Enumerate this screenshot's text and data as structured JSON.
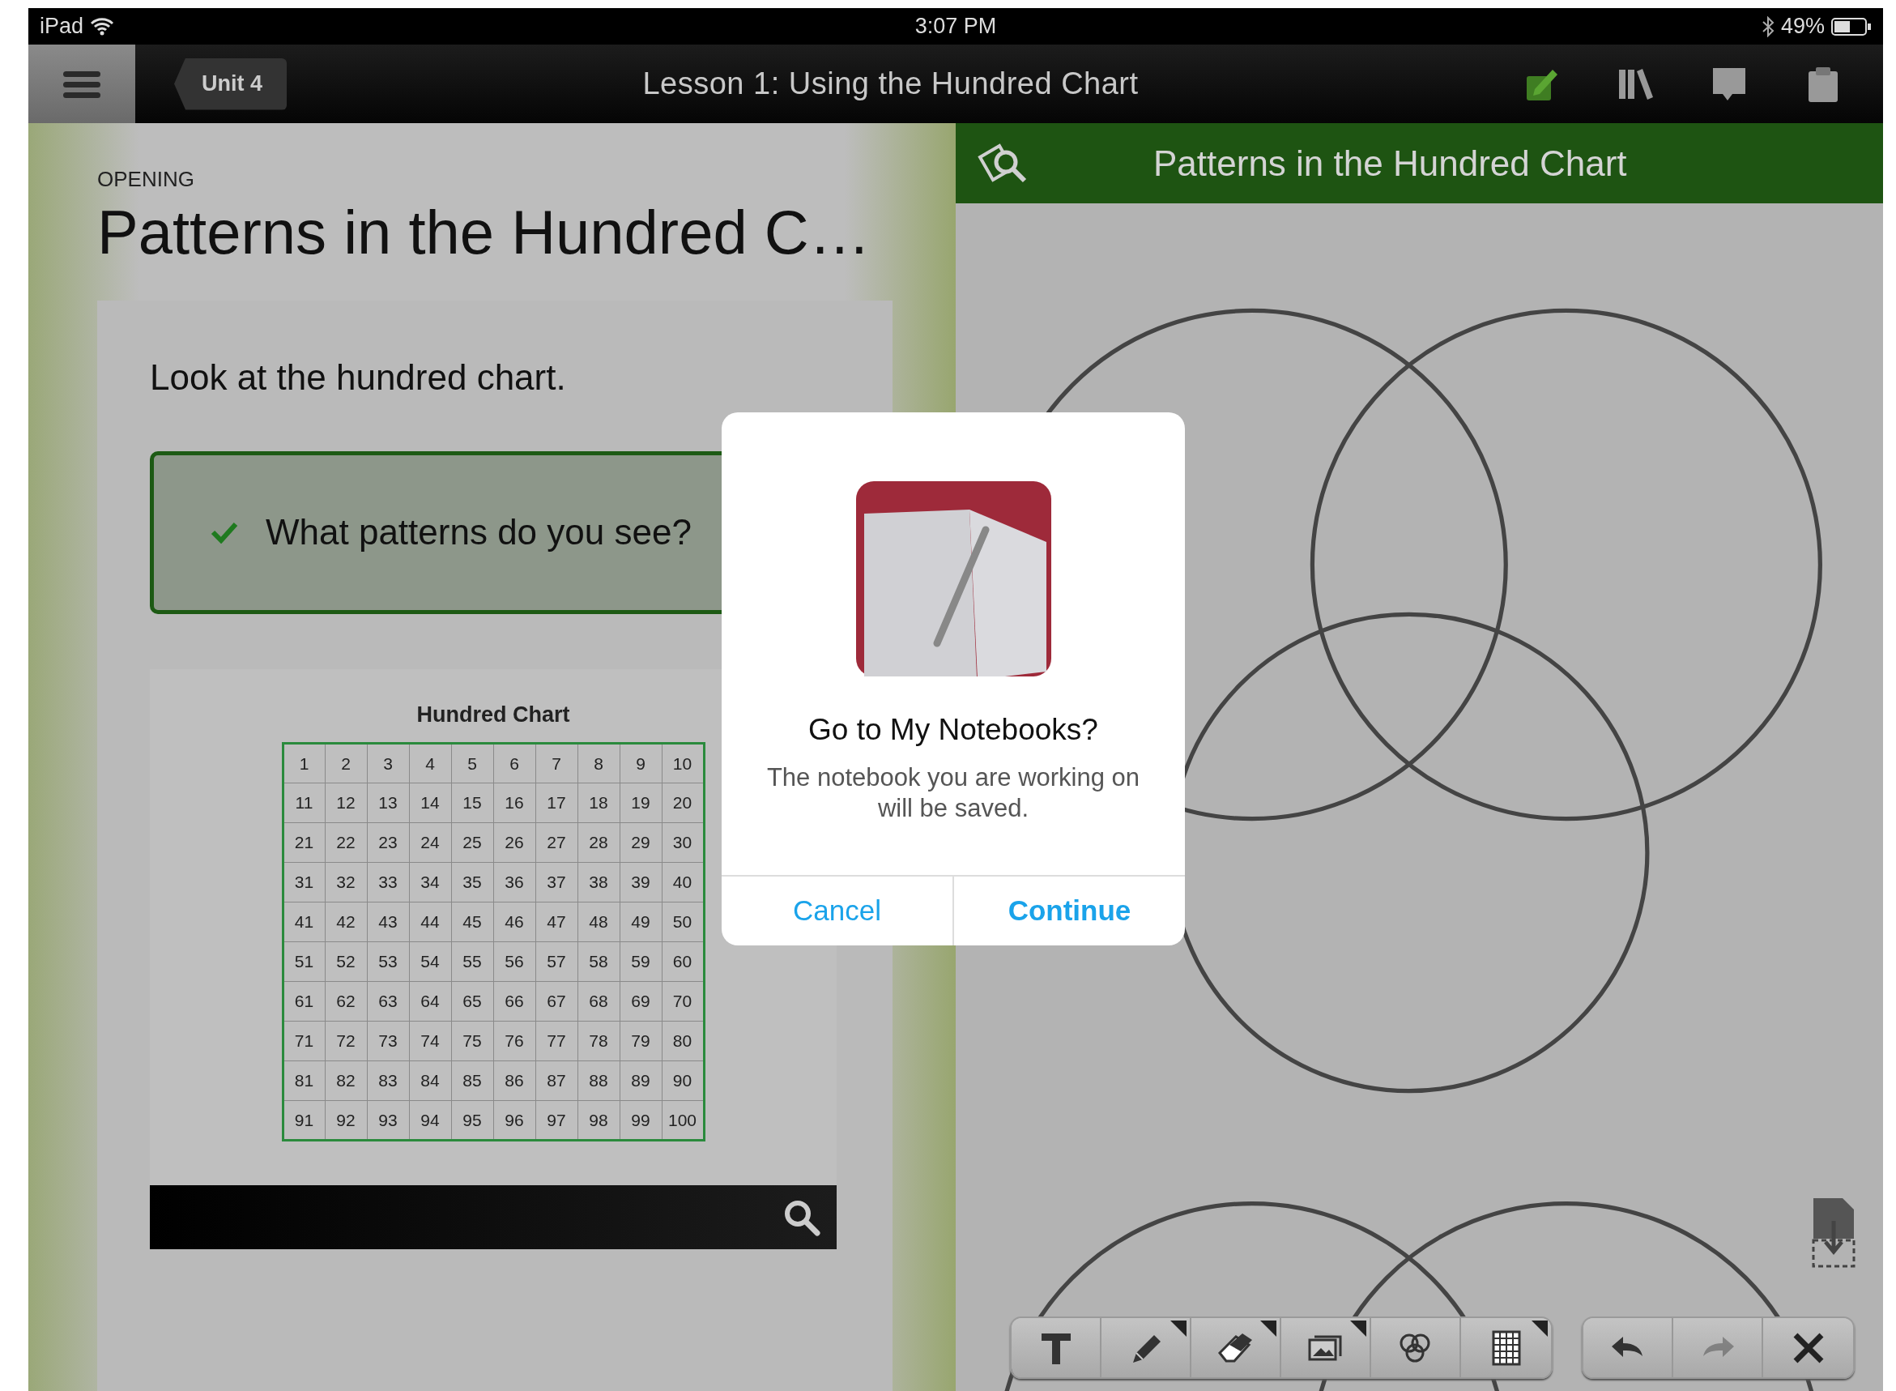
{
  "status_bar": {
    "device": "iPad",
    "time": "3:07 PM",
    "battery": "49%"
  },
  "nav_bar": {
    "back_button": "Unit 4",
    "title": "Lesson 1: Using the Hundred Chart"
  },
  "lesson": {
    "section": "OPENING",
    "title": "Patterns in the Hundred C…",
    "prompt": "Look at the hundred chart.",
    "question": {
      "text": "What patterns do you see?",
      "checked": true
    },
    "hundred_chart": {
      "title": "Hundred Chart",
      "rows": [
        [
          "1",
          "2",
          "3",
          "4",
          "5",
          "6",
          "7",
          "8",
          "9",
          "10"
        ],
        [
          "11",
          "12",
          "13",
          "14",
          "15",
          "16",
          "17",
          "18",
          "19",
          "20"
        ],
        [
          "21",
          "22",
          "23",
          "24",
          "25",
          "26",
          "27",
          "28",
          "29",
          "30"
        ],
        [
          "31",
          "32",
          "33",
          "34",
          "35",
          "36",
          "37",
          "38",
          "39",
          "40"
        ],
        [
          "41",
          "42",
          "43",
          "44",
          "45",
          "46",
          "47",
          "48",
          "49",
          "50"
        ],
        [
          "51",
          "52",
          "53",
          "54",
          "55",
          "56",
          "57",
          "58",
          "59",
          "60"
        ],
        [
          "61",
          "62",
          "63",
          "64",
          "65",
          "66",
          "67",
          "68",
          "69",
          "70"
        ],
        [
          "71",
          "72",
          "73",
          "74",
          "75",
          "76",
          "77",
          "78",
          "79",
          "80"
        ],
        [
          "81",
          "82",
          "83",
          "84",
          "85",
          "86",
          "87",
          "88",
          "89",
          "90"
        ],
        [
          "91",
          "92",
          "93",
          "94",
          "95",
          "96",
          "97",
          "98",
          "99",
          "100"
        ]
      ]
    }
  },
  "workspace": {
    "header": "Patterns in the Hundred Chart",
    "tools": [
      {
        "kind": "text",
        "has_menu": false
      },
      {
        "kind": "pencil",
        "has_menu": true
      },
      {
        "kind": "eraser",
        "has_menu": true
      },
      {
        "kind": "images",
        "has_menu": true
      },
      {
        "kind": "circles",
        "has_menu": false
      },
      {
        "kind": "grid",
        "has_menu": true
      }
    ],
    "actions": [
      {
        "kind": "undo",
        "disabled": false
      },
      {
        "kind": "redo",
        "disabled": true
      },
      {
        "kind": "clear",
        "disabled": false
      }
    ]
  },
  "dialog": {
    "title": "Go to My Notebooks?",
    "message": "The notebook you are working on will be saved.",
    "buttons": [
      {
        "label": "Cancel",
        "primary": false
      },
      {
        "label": "Continue",
        "primary": true
      }
    ]
  }
}
